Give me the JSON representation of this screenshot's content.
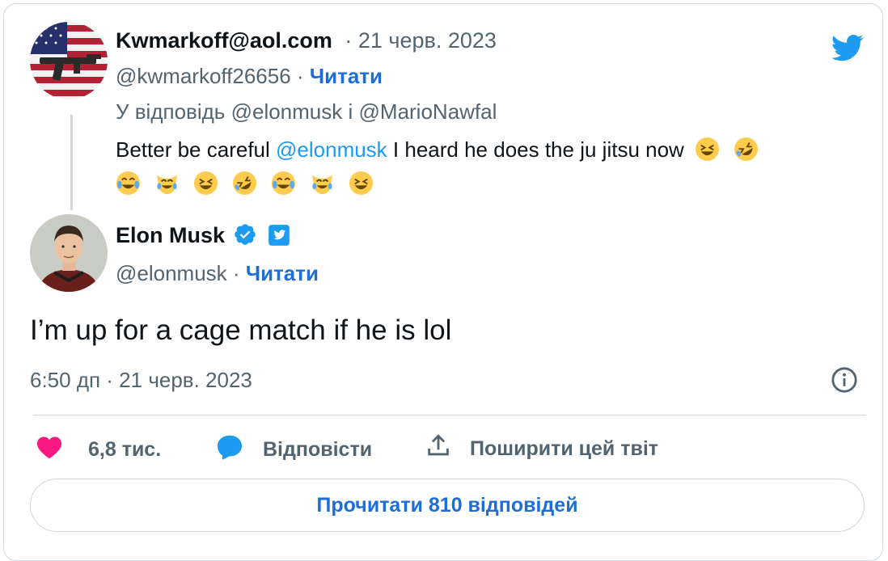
{
  "reply_tweet": {
    "display_name": "Kwmarkoff@aol.com",
    "date": "· 21 черв. 2023",
    "handle": "@kwmarkoff26656",
    "dot": "·",
    "follow_label": "Читати",
    "reply_prefix": "У відповідь",
    "reply_to_1": "@elonmusk",
    "reply_and": "і",
    "reply_to_2": "@MarioNawfal",
    "text_before": "Better be careful",
    "mention": "@elonmusk",
    "text_after": "I heard he does the ju jitsu now"
  },
  "main_tweet": {
    "display_name": "Elon Musk",
    "handle": "@elonmusk",
    "dot": "·",
    "follow_label": "Читати",
    "text": "I’m up for a cage match if he is lol",
    "timestamp": "6:50 дп · 21 черв. 2023"
  },
  "actions": {
    "likes": "6,8 тис.",
    "reply_label": "Відповісти",
    "share_label": "Поширити цей твіт"
  },
  "read_replies_label": "Прочитати 810 відповідей",
  "colors": {
    "brand_blue": "#1d9bf0",
    "link_blue": "#1d6ed8",
    "like_pink": "#f91880",
    "muted": "#536471",
    "border": "#cfd9de"
  },
  "icons": [
    "twitter-bird-icon",
    "verified-badge-icon",
    "twitter-verified-icon",
    "info-icon",
    "heart-icon",
    "reply-bubble-icon",
    "share-icon"
  ]
}
